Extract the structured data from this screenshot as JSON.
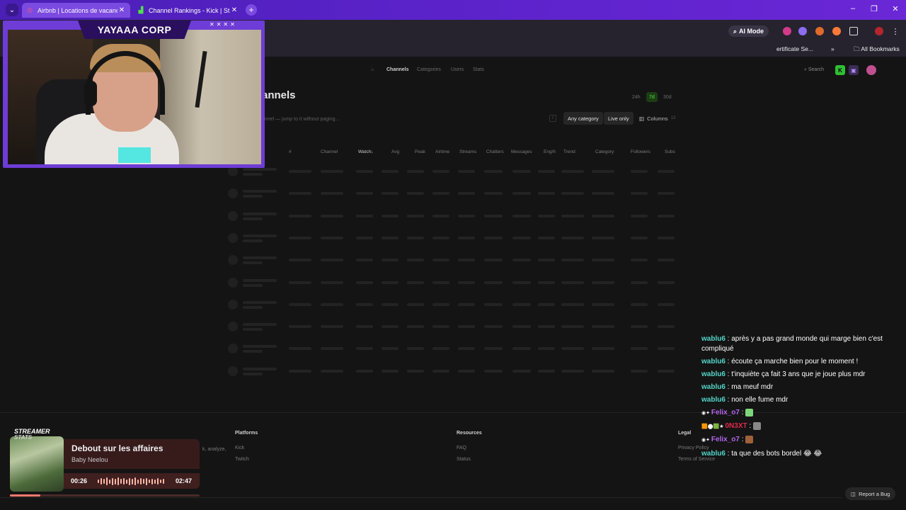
{
  "browser": {
    "tabs": [
      {
        "title": "Airbnb | Locations de vacances",
        "active": true
      },
      {
        "title": "Channel Rankings - Kick | Strea",
        "active": false
      }
    ],
    "ai_mode_label": "AI Mode",
    "bookmarks": {
      "truncated_item": "ertificate Se...",
      "more": "»",
      "all_bookmarks": "All Bookmarks"
    }
  },
  "site": {
    "nav": [
      "Channels",
      "Categories",
      "Users",
      "Stats"
    ],
    "active_nav": "Channels",
    "search_label": "Search",
    "page_title": "annels",
    "time_ranges": [
      "24h",
      "7d",
      "30d"
    ],
    "active_range": "7d",
    "search_placeholder": "annel — jump to it without paging...",
    "search_shortcut": "/",
    "filters": {
      "category": "Any category",
      "live": "Live only",
      "columns": "Columns",
      "columns_count": "13"
    },
    "table_headers": [
      "#",
      "Channel",
      "Watch↓",
      "Avg",
      "Peak",
      "Airtime",
      "Streams",
      "Chatters",
      "Messages",
      "Eng/h",
      "Trend",
      "Category",
      "Followers",
      "Subs"
    ],
    "footer": {
      "tagline_fragment": "k, analyze,",
      "platforms_title": "Platforms",
      "platforms": [
        "Kick",
        "Twitch"
      ],
      "resources_title": "Resources",
      "resources": [
        "FAQ",
        "Status"
      ],
      "legal_title": "Legal",
      "legal": [
        "Privacy Policy",
        "Terms of Service"
      ]
    },
    "report_bug_label": "Report a Bug"
  },
  "stream": {
    "cam_name": "YAYAAA CORP",
    "chat": [
      {
        "user": "wablu6",
        "text": "après y a pas grand monde qui marge bien c'est compliqué",
        "color": "teal"
      },
      {
        "user": "wablu6",
        "text": "écoute ça marche bien pour le moment !",
        "color": "teal"
      },
      {
        "user": "wablu6",
        "text": "t'inquiète ça fait 3 ans que je joue plus mdr",
        "color": "teal"
      },
      {
        "user": "wablu6",
        "text": "ma meuf mdr",
        "color": "teal"
      },
      {
        "user": "wablu6",
        "text": "non elle fume mdr",
        "color": "teal"
      },
      {
        "user": "Felix_o7",
        "text": "",
        "color": "purple"
      },
      {
        "user": "0N3XT",
        "text": "",
        "color": "red"
      },
      {
        "user": "Felix_o7",
        "text": "",
        "color": "purple"
      },
      {
        "user": "wablu6",
        "text": "ta que des bots bordel 😂 😂",
        "color": "teal"
      }
    ],
    "music": {
      "widget_label_1": "STREAMER",
      "widget_label_2": "STATS",
      "title": "Debout sur les affaires",
      "artist": "Baby Neelou",
      "elapsed": "00:26",
      "duration": "02:47",
      "progress": 0.16
    }
  },
  "colors": {
    "accent_purple": "#6e3cd6",
    "kick_green": "#2fbf33",
    "chat_teal": "#54d6c8",
    "chat_purple": "#b565f0",
    "chat_red": "#e0284a"
  }
}
